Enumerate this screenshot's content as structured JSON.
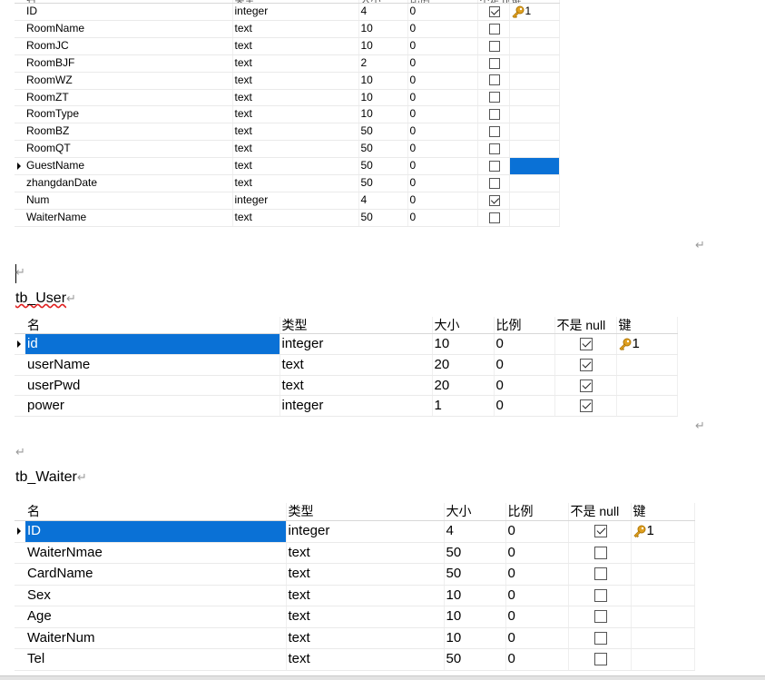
{
  "table1": {
    "rows": [
      {
        "name": "ID",
        "type": "integer",
        "size": "4",
        "scale": "0",
        "notnull": true,
        "key": "1"
      },
      {
        "name": "RoomName",
        "type": "text",
        "size": "10",
        "scale": "0",
        "notnull": false,
        "key": ""
      },
      {
        "name": "RoomJC",
        "type": "text",
        "size": "10",
        "scale": "0",
        "notnull": false,
        "key": ""
      },
      {
        "name": "RoomBJF",
        "type": "text",
        "size": "2",
        "scale": "0",
        "notnull": false,
        "key": ""
      },
      {
        "name": "RoomWZ",
        "type": "text",
        "size": "10",
        "scale": "0",
        "notnull": false,
        "key": ""
      },
      {
        "name": "RoomZT",
        "type": "text",
        "size": "10",
        "scale": "0",
        "notnull": false,
        "key": ""
      },
      {
        "name": "RoomType",
        "type": "text",
        "size": "10",
        "scale": "0",
        "notnull": false,
        "key": ""
      },
      {
        "name": "RoomBZ",
        "type": "text",
        "size": "50",
        "scale": "0",
        "notnull": false,
        "key": ""
      },
      {
        "name": "RoomQT",
        "type": "text",
        "size": "50",
        "scale": "0",
        "notnull": false,
        "key": ""
      },
      {
        "name": "GuestName",
        "type": "text",
        "size": "50",
        "scale": "0",
        "notnull": false,
        "key": ""
      },
      {
        "name": "zhangdanDate",
        "type": "text",
        "size": "50",
        "scale": "0",
        "notnull": false,
        "key": ""
      },
      {
        "name": "Num",
        "type": "integer",
        "size": "4",
        "scale": "0",
        "notnull": true,
        "key": ""
      },
      {
        "name": "WaiterName",
        "type": "text",
        "size": "50",
        "scale": "0",
        "notnull": false,
        "key": ""
      }
    ]
  },
  "section_user": {
    "title": "tb_User"
  },
  "section_waiter": {
    "title": "tb_Waiter"
  },
  "headers": {
    "name": "名",
    "type": "类型",
    "size": "大小",
    "scale": "比例",
    "notnull": "不是 null",
    "key": "键"
  },
  "table2": {
    "rows": [
      {
        "name": "id",
        "type": "integer",
        "size": "10",
        "scale": "0",
        "notnull": true,
        "key": "1"
      },
      {
        "name": "userName",
        "type": "text",
        "size": "20",
        "scale": "0",
        "notnull": true,
        "key": ""
      },
      {
        "name": "userPwd",
        "type": "text",
        "size": "20",
        "scale": "0",
        "notnull": true,
        "key": ""
      },
      {
        "name": "power",
        "type": "integer",
        "size": "1",
        "scale": "0",
        "notnull": true,
        "key": ""
      }
    ]
  },
  "table3": {
    "rows": [
      {
        "name": "ID",
        "type": "integer",
        "size": "4",
        "scale": "0",
        "notnull": true,
        "key": "1"
      },
      {
        "name": "WaiterNmae",
        "type": "text",
        "size": "50",
        "scale": "0",
        "notnull": false,
        "key": ""
      },
      {
        "name": "CardName",
        "type": "text",
        "size": "50",
        "scale": "0",
        "notnull": false,
        "key": ""
      },
      {
        "name": "Sex",
        "type": "text",
        "size": "10",
        "scale": "0",
        "notnull": false,
        "key": ""
      },
      {
        "name": "Age",
        "type": "text",
        "size": "10",
        "scale": "0",
        "notnull": false,
        "key": ""
      },
      {
        "name": "WaiterNum",
        "type": "text",
        "size": "10",
        "scale": "0",
        "notnull": false,
        "key": ""
      },
      {
        "name": "Tel",
        "type": "text",
        "size": "50",
        "scale": "0",
        "notnull": false,
        "key": ""
      }
    ]
  },
  "return_mark": "↵",
  "icons": {
    "key": "key-icon",
    "row_pointer": "row-pointer-icon",
    "return": "paragraph-return-icon"
  },
  "colors": {
    "selection": "#0a71d6",
    "key_gold": "#e0a020",
    "spellcheck": "#e02020"
  }
}
